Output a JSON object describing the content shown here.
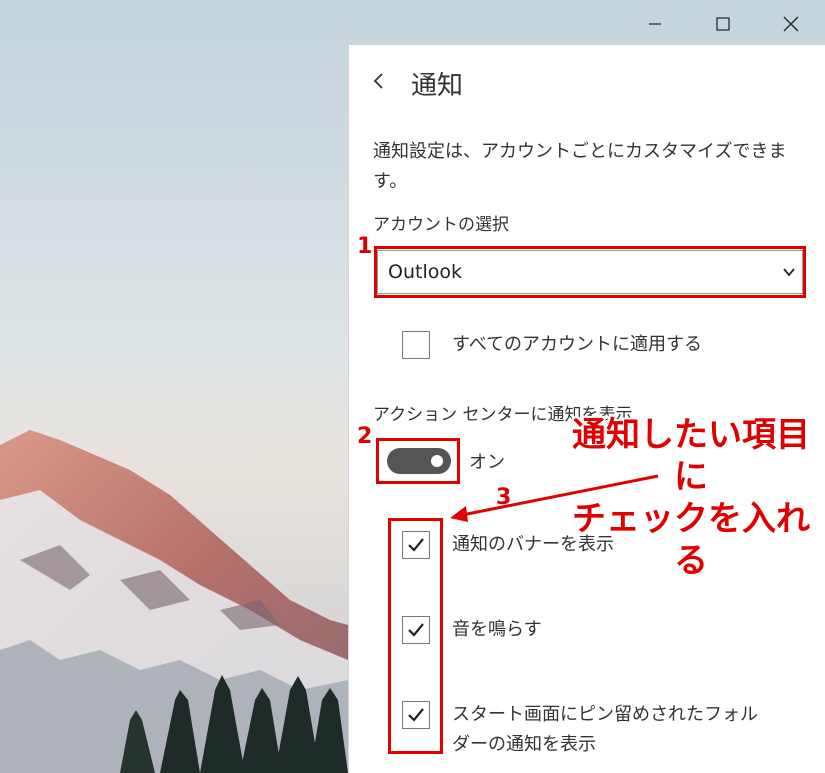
{
  "window": {
    "minimize_icon": "minimize-icon",
    "maximize_icon": "maximize-icon",
    "close_icon": "close-icon"
  },
  "pane": {
    "back_icon": "back-arrow-icon",
    "title": "通知",
    "description": "通知設定は、アカウントごとにカスタマイズできます。",
    "account_label": "アカウントの選択",
    "account_value": "Outlook",
    "apply_all_label": "すべてのアカウントに適用する",
    "apply_all_checked": false,
    "action_center_label": "アクション センターに通知を表示",
    "action_center_toggle": "オン",
    "options": [
      {
        "label": "通知のバナーを表示",
        "checked": true
      },
      {
        "label": "音を鳴らす",
        "checked": true
      },
      {
        "label": "スタート画面にピン留めされたフォルダーの通知を表示",
        "checked": true
      }
    ]
  },
  "annotations": {
    "step1": "1",
    "step2": "2",
    "step3": "3",
    "callout_line1": "通知したい項目に",
    "callout_line2": "チェックを入れる",
    "color": "#e00000"
  }
}
